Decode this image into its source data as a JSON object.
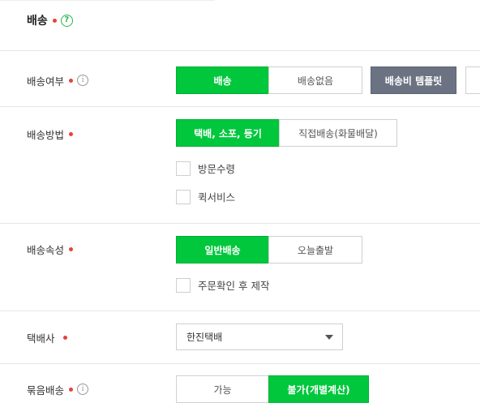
{
  "section": {
    "title": "배송",
    "help_icon_glyph": "?"
  },
  "rows": {
    "delivery_status": {
      "label": "배송여부",
      "options": [
        "배송",
        "배송없음"
      ],
      "selected": "배송",
      "template_button": "배송비 템플릿"
    },
    "delivery_method": {
      "label": "배송방법",
      "options": [
        "택배, 소포, 등기",
        "직접배송(화물배달)"
      ],
      "selected": "택배, 소포, 등기",
      "checkboxes": [
        "방문수령",
        "퀵서비스"
      ]
    },
    "delivery_attribute": {
      "label": "배송속성",
      "options": [
        "일반배송",
        "오늘출발"
      ],
      "selected": "일반배송",
      "checkboxes": [
        "주문확인 후 제작"
      ]
    },
    "courier": {
      "label": "택배사",
      "selected_value": "한진택배"
    },
    "bundle_delivery": {
      "label": "묶음배송",
      "options": [
        "가능",
        "불가(개별계산)"
      ],
      "selected": "불가(개별계산)"
    }
  },
  "icons": {
    "info_glyph": "i"
  },
  "colors": {
    "accent": "#00c73c",
    "required_dot": "#e8413a",
    "dark_button": "#6b7382"
  }
}
